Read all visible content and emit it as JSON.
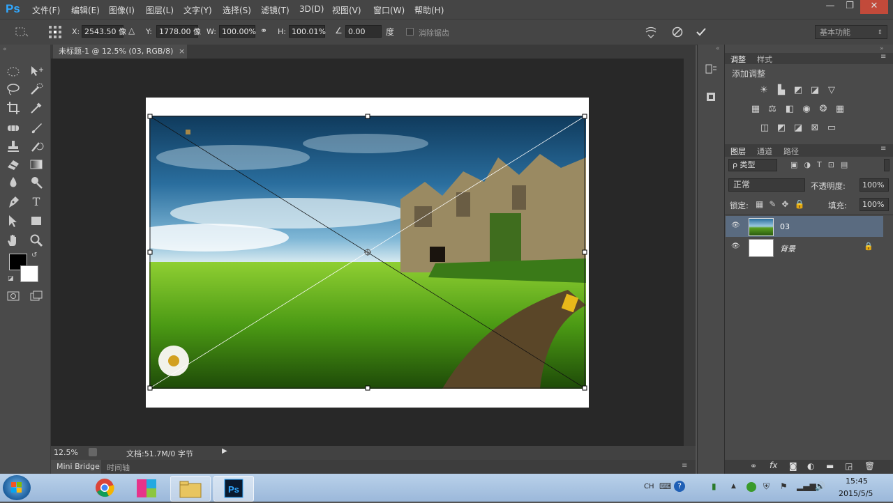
{
  "app": {
    "logo": "Ps"
  },
  "menu": [
    "文件(F)",
    "编辑(E)",
    "图像(I)",
    "图层(L)",
    "文字(Y)",
    "选择(S)",
    "滤镜(T)",
    "3D(D)",
    "视图(V)",
    "窗口(W)",
    "帮助(H)"
  ],
  "window_controls": {
    "minimize": "—",
    "restore": "❐",
    "close": "✕"
  },
  "options": {
    "x_label": "X:",
    "x_value": "2543.50 像",
    "y_label": "Y:",
    "y_value": "1778.00 像",
    "w_label": "W:",
    "w_value": "100.00%",
    "h_label": "H:",
    "h_value": "100.01%",
    "angle_value": "0.00",
    "angle_unit": "度",
    "antialias_label": "消除锯齿",
    "workspace": "基本功能"
  },
  "document": {
    "tab_title": "未标题-1 @ 12.5% (03, RGB/8)",
    "tab_close": "×",
    "zoom": "12.5%",
    "doc_info": "文档:51.7M/0 字节"
  },
  "bottom_tabs": [
    "Mini Bridge",
    "时间轴"
  ],
  "adjustments_panel": {
    "tabs": [
      "调整",
      "样式"
    ],
    "subtitle": "添加调整"
  },
  "layers_panel": {
    "tabs": [
      "图层",
      "通道",
      "路径"
    ],
    "filter_label": "ρ 类型",
    "blend_mode": "正常",
    "opacity_label": "不透明度:",
    "opacity_value": "100%",
    "lock_label": "锁定:",
    "fill_label": "填充:",
    "fill_value": "100%",
    "layers": [
      {
        "name": "03",
        "selected": true
      },
      {
        "name": "背景",
        "selected": false
      }
    ]
  },
  "taskbar": {
    "ime": "CH",
    "time": "15:45",
    "date": "2015/5/5"
  },
  "colors": {
    "accent": "#31a8ff",
    "selection": "#5a6b80",
    "panel": "#4a4a4a",
    "canvas_bg": "#282828"
  }
}
